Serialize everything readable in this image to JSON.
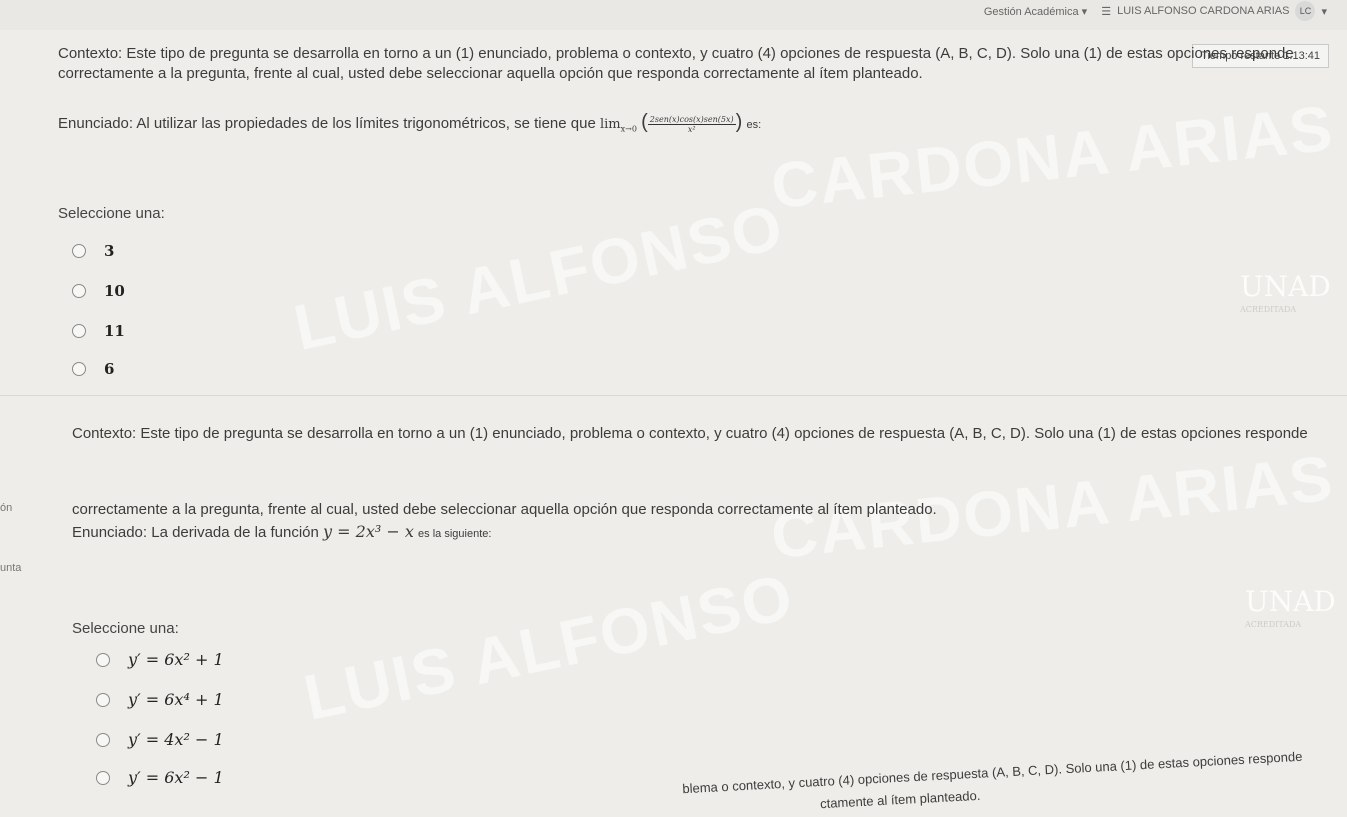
{
  "topbar": {
    "menu_label": "Gestión Académica",
    "user_name": "LUIS ALFONSO CARDONA ARIAS",
    "user_initials": "LC"
  },
  "timer": {
    "label": "Tiempo restante 1:13:41"
  },
  "q1": {
    "context_line1": "Contexto: Este tipo de pregunta se desarrolla en torno a un (1) enunciado, problema o contexto, y cuatro (4) opciones de respuesta (A, B, C, D). Solo una (1) de estas opciones responde",
    "context_line2": "correctamente a la pregunta, frente al cual, usted debe seleccionar aquella opción que responda correctamente al ítem planteado.",
    "statement_prefix": "Enunciado: Al utilizar las propiedades de los límites trigonométricos, se tiene que",
    "limit_label": "lim",
    "limit_sub": "x→0",
    "fraction_num": "2sen(x)cos(x)sen(5x)",
    "fraction_den": "x²",
    "statement_suffix": "es:",
    "select_label": "Seleccione una:",
    "options": [
      "3",
      "10",
      "11",
      "6"
    ]
  },
  "q2": {
    "context_line1": "Contexto: Este tipo de pregunta se desarrolla en torno a un (1) enunciado, problema o contexto, y cuatro (4) opciones de respuesta (A, B, C, D). Solo una (1) de estas opciones responde",
    "context_line2": "correctamente a la pregunta, frente al cual, usted debe seleccionar aquella opción que responda correctamente al ítem planteado.",
    "statement_prefix": "Enunciado: La derivada de la función",
    "function": "y = 2x³ − x",
    "statement_suffix": "es la siguiente:",
    "select_label": "Seleccione una:",
    "options": [
      "y′ = 6x² + 1",
      "y′ = 6x⁴ + 1",
      "y′ = 4x² − 1",
      "y′ = 6x² − 1"
    ]
  },
  "q3": {
    "context_partial1": "blema o contexto, y cuatro (4) opciones de respuesta (A, B, C, D). Solo una (1) de estas opciones responde",
    "context_partial2": "ctamente al ítem planteado."
  },
  "side": {
    "label1": "ón",
    "label2": "unta"
  },
  "watermark": {
    "line1": "CARDONA ARIAS",
    "line2": "LUIS ALFONSO",
    "logo": "UNAD",
    "logo_sub": "ACREDITADA"
  }
}
